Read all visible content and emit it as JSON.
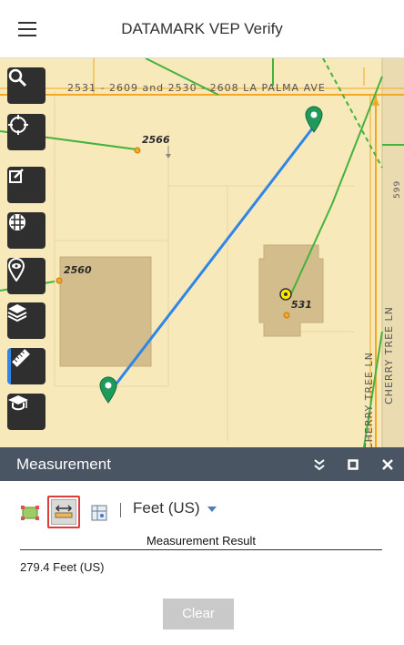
{
  "app": {
    "title": "DATAMARK VEP Verify"
  },
  "map": {
    "street_labels": [
      "2531 - 2609 and 2530 - 2608 LA PALMA AVE",
      "CHERRY TREE LN",
      "CHERRY TREE LN",
      "599"
    ],
    "address_labels": [
      "2566",
      "2560",
      "531"
    ],
    "toolbar": [
      {
        "name": "search-icon",
        "label": "Search"
      },
      {
        "name": "locate-icon",
        "label": "Locate"
      },
      {
        "name": "edit-icon",
        "label": "Edit"
      },
      {
        "name": "basemap-icon",
        "label": "Basemap"
      },
      {
        "name": "layer-visibility-icon",
        "label": "Visibility"
      },
      {
        "name": "layers-icon",
        "label": "Layers"
      },
      {
        "name": "measure-icon",
        "label": "Measure"
      },
      {
        "name": "about-icon",
        "label": "About"
      }
    ],
    "colors": {
      "road": "#f5a623",
      "parcel_line": "#44b23e",
      "measure_line": "#2f86e6",
      "building": "#d4bd8c",
      "marker": "#1e9a5a"
    }
  },
  "panel": {
    "title": "Measurement",
    "unit": "Feet (US)",
    "result_header": "Measurement Result",
    "result_value": "279.4 Feet (US)",
    "clear_label": "Clear",
    "tools": [
      "area-tool-icon",
      "distance-tool-icon",
      "location-tool-icon"
    ]
  }
}
